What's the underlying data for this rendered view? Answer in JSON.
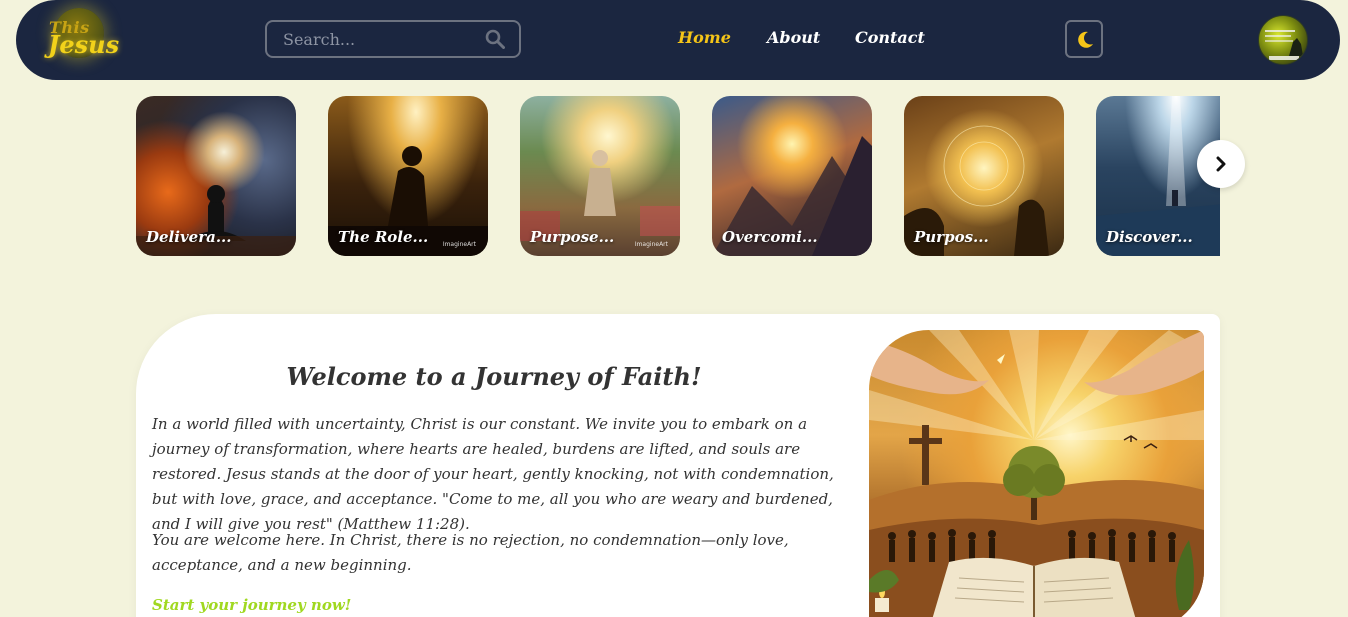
{
  "brand": {
    "line1": "This",
    "line2": "Jesus"
  },
  "search": {
    "placeholder": "Search..."
  },
  "nav": {
    "links": [
      {
        "label": "Home",
        "active": true
      },
      {
        "label": "About",
        "active": false
      },
      {
        "label": "Contact",
        "active": false
      }
    ]
  },
  "carousel": {
    "cards": [
      {
        "label": "Delivera..."
      },
      {
        "label": "The Role...",
        "watermark": "ImagineArt"
      },
      {
        "label": "Purpose...",
        "watermark": "ImagineArt"
      },
      {
        "label": "Overcomi..."
      },
      {
        "label": "Purpos..."
      },
      {
        "label": "Discover..."
      }
    ]
  },
  "welcome": {
    "title": "Welcome to a Journey of Faith!",
    "paragraph1": "In a world filled with uncertainty, Christ is our constant. We invite you to embark on a journey of transformation, where hearts are healed, burdens are lifted, and souls are restored. Jesus stands at the door of your heart, gently knocking, not with condemnation, but with love, grace, and acceptance. \"Come to me, all you who are weary and burdened, and I will give you rest\" (Matthew 11:28).",
    "paragraph2": "You are welcome here. In Christ, there is no rejection, no condemnation—only love, acceptance, and a new beginning.",
    "cta": "Start your journey now!"
  },
  "colors": {
    "navbar_bg": "#1b2640",
    "page_bg": "#f3f3dc",
    "active_link": "#f5c518",
    "cta": "#a0d820"
  },
  "icons": [
    "search-icon",
    "moon-icon",
    "chevron-right-icon"
  ]
}
